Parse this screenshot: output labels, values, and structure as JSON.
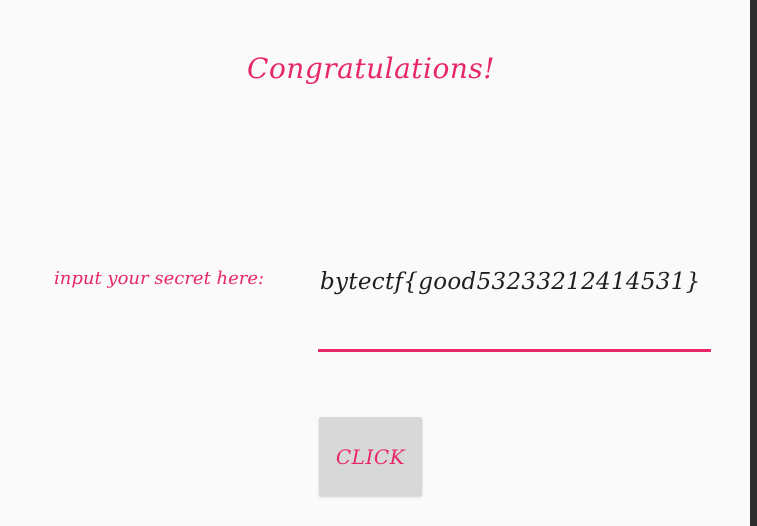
{
  "screen": {
    "headline": "Congratulations!",
    "secret_label": "input your secret here:",
    "secret_value": "bytectf{good53233212414531}",
    "button_label": "CLICK"
  },
  "colors": {
    "accent": "#e8276a",
    "background": "#fafafa",
    "button_bg": "#d8d8d8",
    "text": "#1f1f1f"
  }
}
